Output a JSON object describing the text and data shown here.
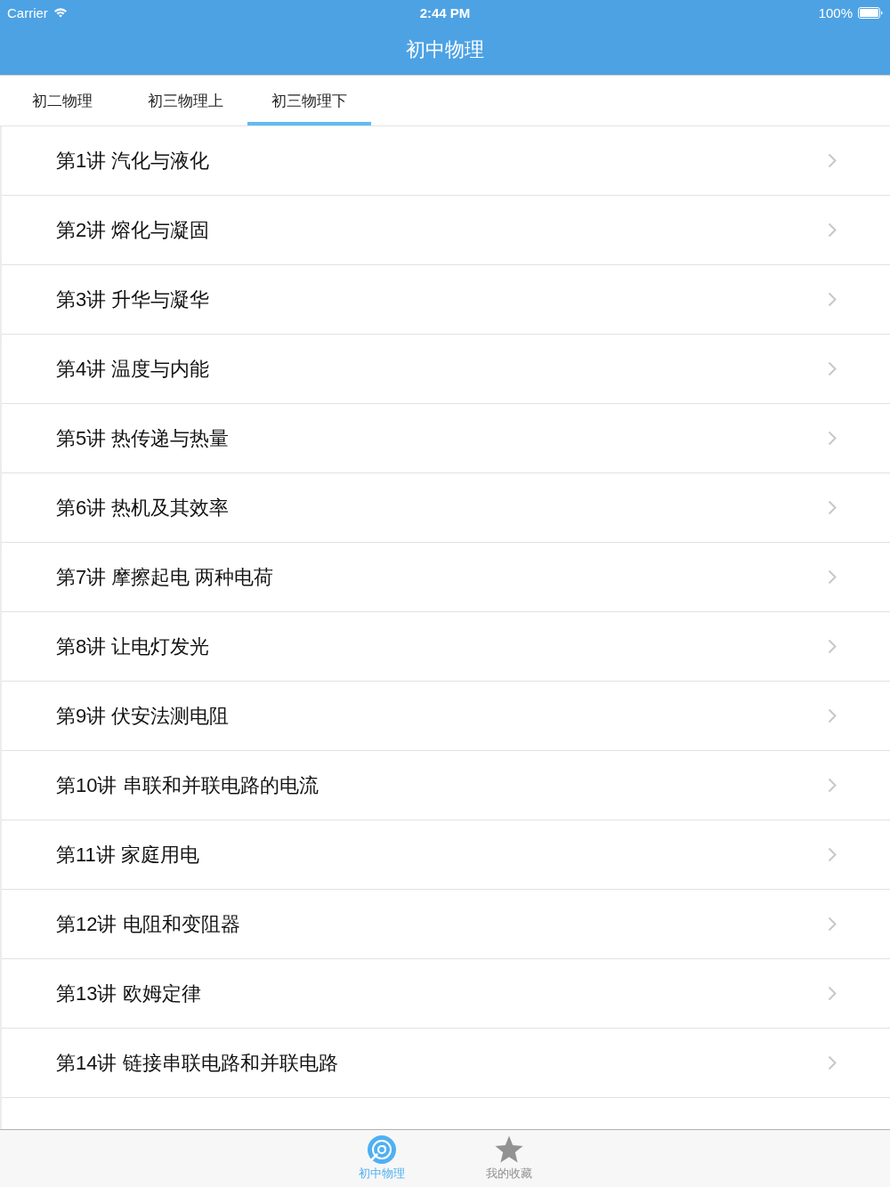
{
  "status_bar": {
    "carrier": "Carrier",
    "time": "2:44 PM",
    "battery": "100%"
  },
  "nav_bar": {
    "title": "初中物理"
  },
  "tabs": [
    {
      "label": "初二物理",
      "selected": false
    },
    {
      "label": "初三物理上",
      "selected": false
    },
    {
      "label": "初三物理下",
      "selected": true
    }
  ],
  "lessons": [
    "第1讲 汽化与液化",
    "第2讲 熔化与凝固",
    "第3讲 升华与凝华",
    "第4讲 温度与内能",
    "第5讲 热传递与热量",
    "第6讲 热机及其效率",
    "第7讲 摩擦起电 两种电荷",
    "第8讲 让电灯发光",
    "第9讲 伏安法测电阻",
    "第10讲 串联和并联电路的电流",
    "第11讲 家庭用电",
    "第12讲 电阻和变阻器",
    "第13讲 欧姆定律",
    "第14讲 链接串联电路和并联电路"
  ],
  "tab_bar": {
    "items": [
      {
        "label": "初中物理",
        "kind": "disc",
        "selected": true
      },
      {
        "label": "我的收藏",
        "kind": "star",
        "selected": false
      }
    ]
  }
}
